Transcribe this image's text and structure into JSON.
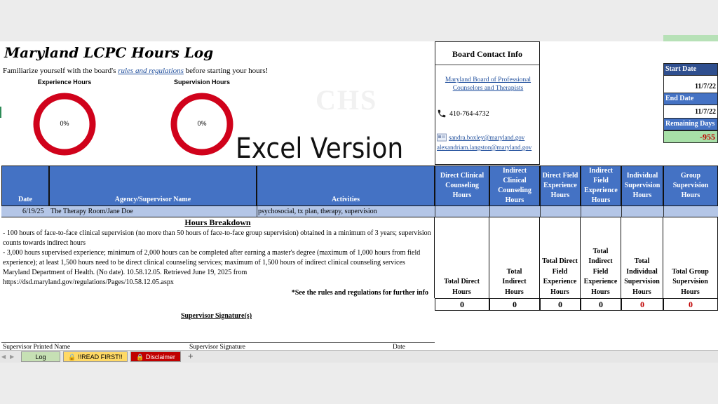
{
  "title": "Maryland LCPC Hours Log",
  "intro": {
    "before": "Familiarize yourself with the board's ",
    "link": "rules and regulations",
    "after": " before starting your hours!"
  },
  "charts": {
    "experience": {
      "label": "Experience Hours",
      "percent_text": "0%"
    },
    "supervision": {
      "label": "Supervision Hours",
      "percent_text": "0%"
    }
  },
  "chart_data": [
    {
      "type": "pie",
      "title": "Experience Hours",
      "values": [
        0,
        100
      ],
      "center_label": "0%"
    },
    {
      "type": "pie",
      "title": "Supervision Hours",
      "values": [
        0,
        100
      ],
      "center_label": "0%"
    }
  ],
  "watermark": "CHS",
  "overlay_text": "Excel Version",
  "contact": {
    "title": "Board Contact Info",
    "board_link": "Maryland Board of Professional Counselors and Therapists",
    "phone": "410-764-4732",
    "email1": "sandra.boxley@maryland.gov",
    "email2": "alexandriam.langston@maryland.gov"
  },
  "dates": {
    "start_label": "Start Date",
    "start_value": "11/7/22",
    "end_label": "End Date",
    "end_value": "11/7/22",
    "remaining_label": "Remaining Days",
    "remaining_value": "-955"
  },
  "table": {
    "headers": {
      "date": "Date",
      "agency": "Agency/Supervisor Name",
      "activities": "Activities",
      "direct_clinical": "Direct Clinical Counseling Hours",
      "indirect_clinical": "Indirect Clinical Counseling Hours",
      "direct_field": "Direct Field Experience Hours",
      "indirect_field": "Indirect Field Experience Hours",
      "individual_sup": "Individual Supervision Hours",
      "group_sup": "Group Supervision Hours"
    },
    "row": {
      "date": "6/19/25",
      "agency": "The Therapy Room/Jane Doe",
      "activities": "psychosocial, tx plan, therapy, supervision"
    }
  },
  "breakdown": {
    "title": "Hours Breakdown",
    "line1": "- 100 hours of face-to-face clinical supervision (no more than 50 hours of face-to-face group supervision) obtained in a minimum of 3 years; supervision counts towards indirect hours",
    "line2": "- 3,000 hours supervised experience; minimum of 2,000 hours can be completed after earning a master's degree (maximum of 1,000 hours from field experience); at least 1,500 hours need to be direct clinical counseling services; maximum of 1,500 hours of indirect clinical counseling services",
    "line3": "Maryland Department of Health. (No date). 10.58.12.05. Retrieved June 19, 2025 from https://dsd.maryland.gov/regulations/Pages/10.58.12.05.aspx",
    "note": "*See the rules and regulations for further info"
  },
  "totals": {
    "direct": {
      "label": "Total Direct Hours",
      "value": "0"
    },
    "indirect": {
      "label": "Total Indirect Hours",
      "value": "0"
    },
    "direct_field": {
      "label": "Total Direct Field Experience Hours",
      "value": "0"
    },
    "indirect_field": {
      "label": "Total Indirect Field Experience Hours",
      "value": "0"
    },
    "individual": {
      "label": "Total Individual Supervision Hours",
      "value": "0"
    },
    "group": {
      "label": "Total Group Supervision Hours",
      "value": "0"
    }
  },
  "signature": {
    "title": "Supervisor Signature(s)",
    "printed": "Supervisor Printed Name",
    "sig": "Supervisor Signature",
    "date": "Date"
  },
  "tabs": [
    {
      "label": "Log",
      "color": "#c6e0b4"
    },
    {
      "label": "!!READ FIRST!!",
      "color": "#ffd966"
    },
    {
      "label": "Disclaimer",
      "color": "#c00000"
    }
  ],
  "colors": {
    "header_blue": "#4472c4",
    "row_blue": "#b4c6e7",
    "donut_red": "#d0021b",
    "remaining_green": "#a8e0a8"
  }
}
